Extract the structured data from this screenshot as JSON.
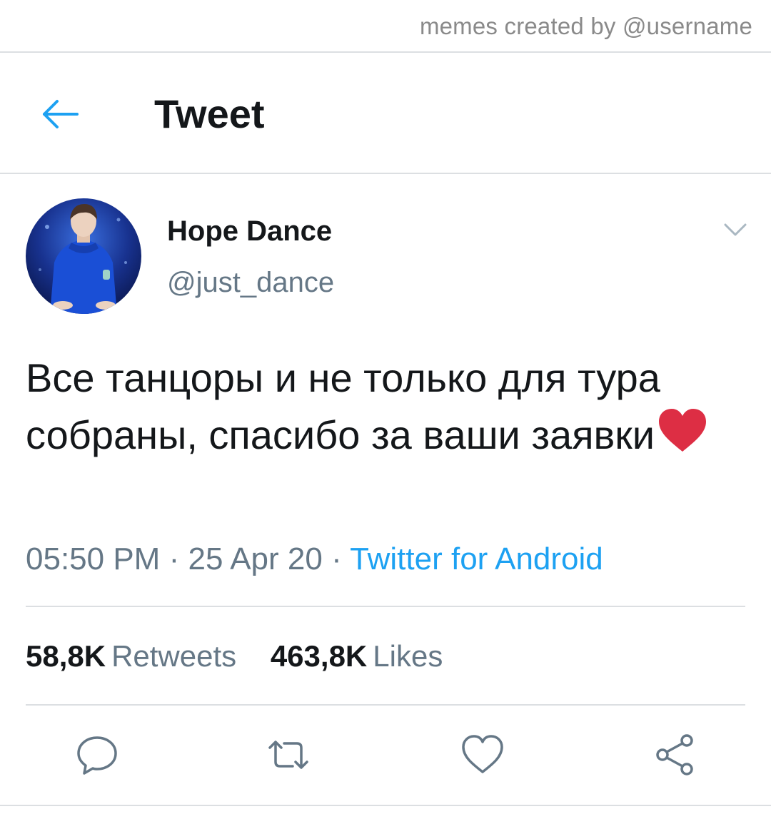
{
  "watermark": "memes created by @username",
  "header": {
    "title": "Tweet",
    "back_icon": "arrow-left-icon"
  },
  "tweet": {
    "display_name": "Hope Dance",
    "handle": "@just_dance",
    "text": "Все танцоры и не только для тура собраны, спасибо за ваши заявки",
    "emoji": "red-heart",
    "time": "05:50 PM",
    "date": "25 Apr 20",
    "separator": "·",
    "source": "Twitter for Android",
    "stats": {
      "retweets_count": "58,8K",
      "retweets_label": "Retweets",
      "likes_count": "463,8K",
      "likes_label": "Likes"
    }
  },
  "actions": [
    "reply-icon",
    "retweet-icon",
    "like-icon",
    "share-icon"
  ],
  "colors": {
    "accent": "#1da1f2",
    "text_primary": "#14171a",
    "text_secondary": "#657786",
    "divider": "#dcdfe2",
    "avatar_hoodie": "#1a4fd6"
  }
}
